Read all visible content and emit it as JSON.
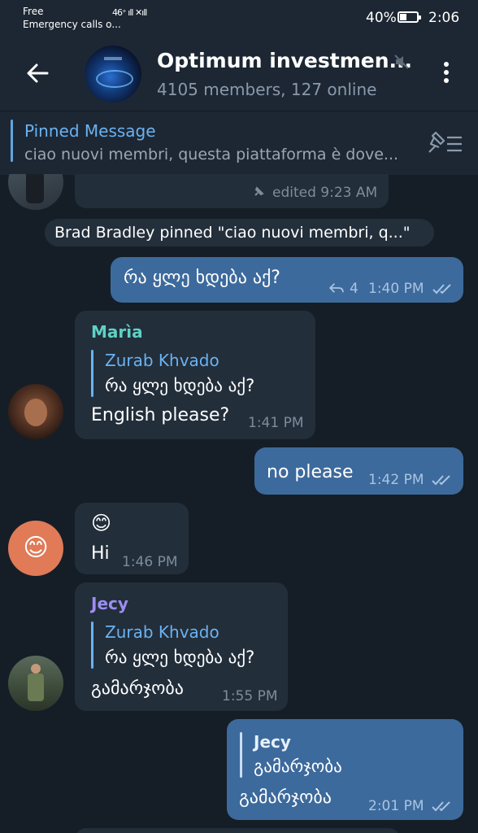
{
  "status_bar": {
    "carrier_line1": "Free",
    "carrier_line2": "Emergency calls o...",
    "signal": "46⁺ ıll ✕ıll",
    "battery_percent": "40%",
    "battery_level": 0.4,
    "time": "2:06"
  },
  "header": {
    "title": "Optimum investmen...",
    "subtitle": "4105 members, 127 online",
    "icons": [
      "back-arrow-icon",
      "mute-icon",
      "more-vertical-icon"
    ]
  },
  "pinned": {
    "title": "Pinned Message",
    "text": "ciao nuovi membri, questa piattaforma è dove..."
  },
  "messages": [
    {
      "type": "in",
      "status": "edited 9:23 AM",
      "icon": "pin-icon"
    },
    {
      "type": "service",
      "text": "Brad Bradley pinned \"ciao nuovi membri, q...\""
    },
    {
      "type": "out",
      "text": "რა ყლე ხდება აქ?",
      "reply_count": "4",
      "time": "1:40 PM"
    },
    {
      "type": "in",
      "sender": "Marìa",
      "sender_color": "#5fd1c5",
      "quote_name": "Zurab Khvado",
      "quote_text": "რა ყლე ხდება აქ?",
      "text": "English please?",
      "time": "1:41 PM"
    },
    {
      "type": "out",
      "text": "no please",
      "time": "1:42 PM"
    },
    {
      "type": "in",
      "emoji": "😊",
      "text": "Hi",
      "time": "1:46 PM",
      "avatar_emoji": "😊"
    },
    {
      "type": "in",
      "sender": "Jecy",
      "sender_color": "#9d8df1",
      "quote_name": "Zurab Khvado",
      "quote_text": "რა ყლე ხდება აქ?",
      "text": "გამარჯობა",
      "time": "1:55 PM"
    },
    {
      "type": "out",
      "quote_name": "Jecy",
      "quote_text": "გამარჯობა",
      "text": "გამარჯობა",
      "time": "2:01 PM"
    }
  ],
  "colors": {
    "background": "#151e27",
    "header": "#1d2733",
    "incoming_bubble": "#222e3a",
    "outgoing_bubble": "#3d6a9c",
    "accent": "#6ab2f2"
  }
}
